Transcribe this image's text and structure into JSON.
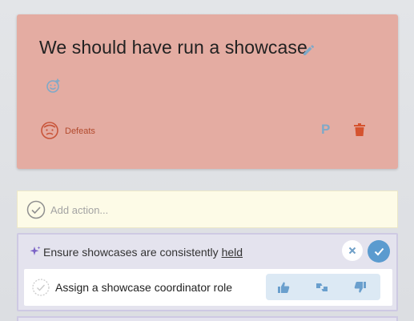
{
  "card": {
    "title": "We should have run a showcase",
    "category_label": "Defeats",
    "owner_initial": "P"
  },
  "add_action": {
    "placeholder": "Add action..."
  },
  "suggestion": {
    "text_prefix": "Ensure showcases are consistently ",
    "text_highlight": "held",
    "item": {
      "text": "Assign a showcase coordinator role"
    }
  },
  "colors": {
    "card_bg": "#e4aca2",
    "category": "#b24a2d",
    "accent_blue": "#5b9bcf",
    "add_action_bg": "#fdfbe7",
    "suggest_bg": "#e4e3ee"
  },
  "icons": [
    "pencil-icon",
    "add-reaction-icon",
    "defeat-face-icon",
    "trash-icon",
    "check-circle-icon",
    "sparkle-icon",
    "close-icon",
    "check-icon",
    "thumbs-up-icon",
    "thumbs-sideways-icon",
    "thumbs-down-icon"
  ]
}
